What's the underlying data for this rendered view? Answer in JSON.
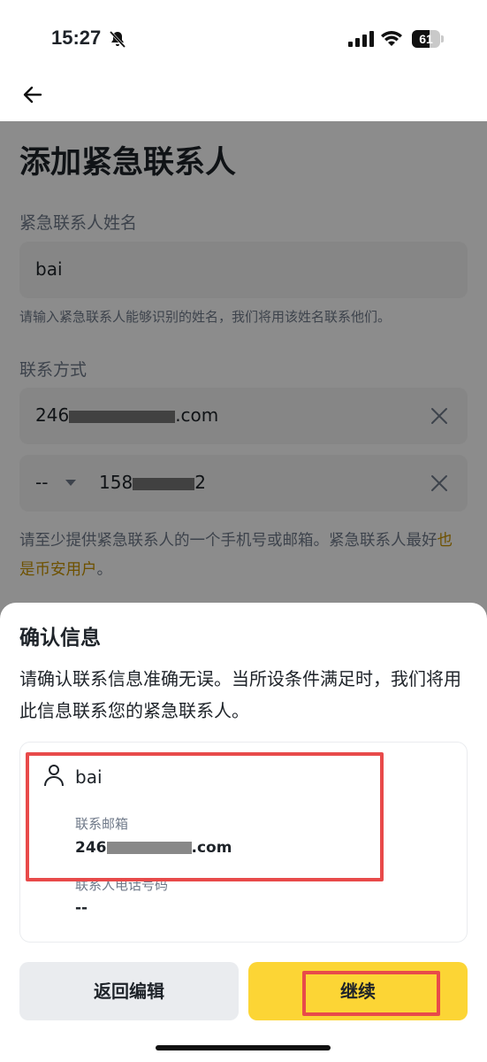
{
  "status_bar": {
    "time": "15:27",
    "battery": "61",
    "battery_level": 0.61
  },
  "page": {
    "title": "添加紧急联系人",
    "name_label": "紧急联系人姓名",
    "name_value": "bai",
    "name_hint": "请输入紧急联系人能够识别的姓名，我们将用该姓名联系他们。",
    "contact_label": "联系方式",
    "email_prefix": "246",
    "email_suffix": ".com",
    "phone_prefix": "--",
    "phone_start": "158",
    "phone_end": "2",
    "contact_hint": "请至少提供紧急联系人的一个手机号或邮箱。紧急联系人最好",
    "contact_hint_link": "也是币安用户",
    "contact_hint_end": "。"
  },
  "sheet": {
    "title": "确认信息",
    "description": "请确认联系信息准确无误。当所设条件满足时，我们将用此信息联系您的紧急联系人。",
    "name": "bai",
    "email_label": "联系邮箱",
    "email_prefix": "246",
    "email_suffix": ".com",
    "phone_label": "联系人电话号码",
    "phone_value": "--",
    "back_button": "返回编辑",
    "continue_button": "继续"
  },
  "colors": {
    "accent": "#fcd535",
    "link": "#c99400",
    "highlight": "#e84a4a",
    "text": "#1e2329",
    "muted": "#707a8a"
  }
}
